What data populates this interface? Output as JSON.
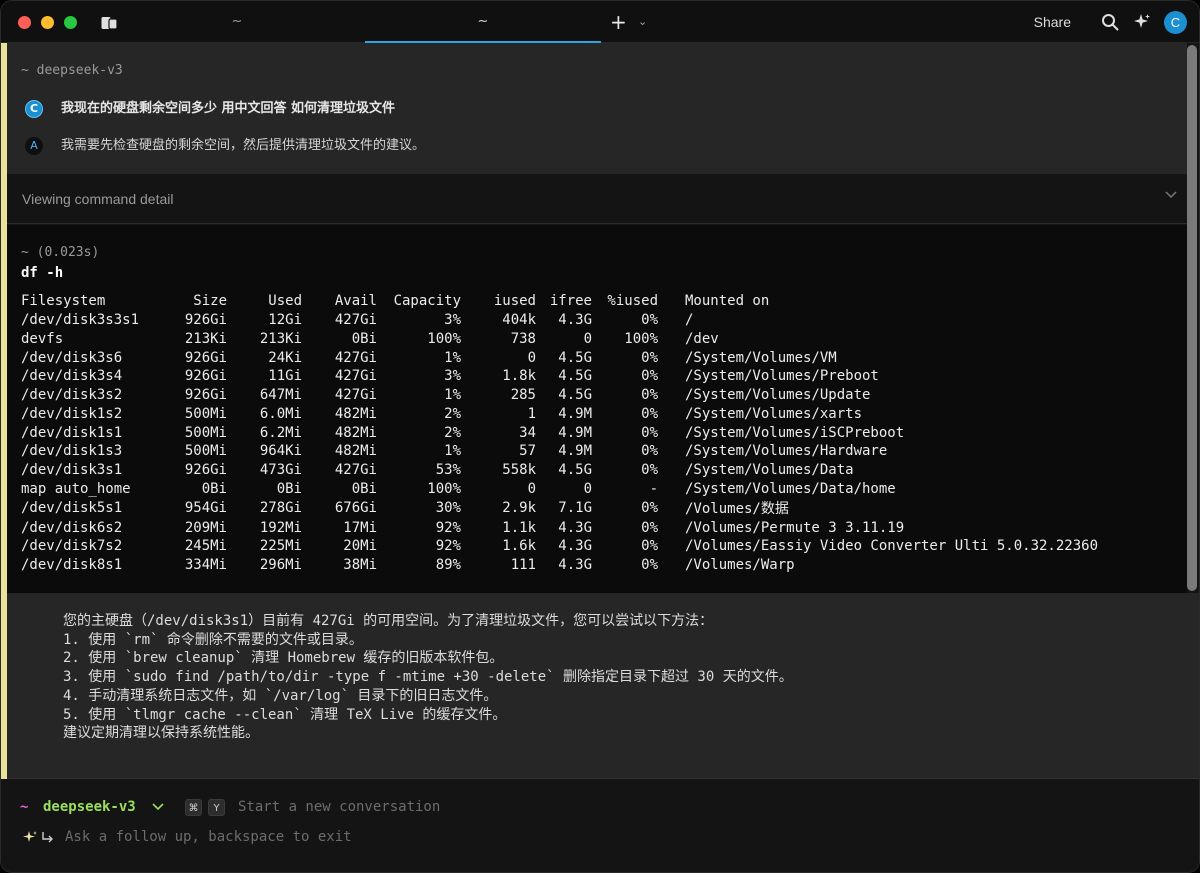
{
  "titlebar": {
    "tabs": [
      {
        "label": "~"
      },
      {
        "label": "~"
      }
    ],
    "new_tab_icon": "plus-icon",
    "share_label": "Share",
    "avatar_letter": "C",
    "accent_color": "#2aa6de"
  },
  "conversation": {
    "path": "~ deepseek-v3",
    "user_avatar": "C",
    "user_message": "我现在的硬盘剩余空间多少 用中文回答 如何清理垃圾文件",
    "ai_icon": "A",
    "ai_message": "我需要先检查硬盘的剩余空间，然后提供清理垃圾文件的建议。"
  },
  "detail": {
    "label": "Viewing command detail"
  },
  "command": {
    "time": "~ (0.023s)",
    "text": "df -h",
    "headers": [
      "Filesystem",
      "Size",
      "Used",
      "Avail",
      "Capacity",
      "iused",
      "ifree",
      "%iused",
      "Mounted on"
    ],
    "rows": [
      [
        "/dev/disk3s3s1",
        "926Gi",
        "12Gi",
        "427Gi",
        "3%",
        "404k",
        "4.3G",
        "0%",
        "/"
      ],
      [
        "devfs",
        "213Ki",
        "213Ki",
        "0Bi",
        "100%",
        "738",
        "0",
        "100%",
        "/dev"
      ],
      [
        "/dev/disk3s6",
        "926Gi",
        "24Ki",
        "427Gi",
        "1%",
        "0",
        "4.5G",
        "0%",
        "/System/Volumes/VM"
      ],
      [
        "/dev/disk3s4",
        "926Gi",
        "11Gi",
        "427Gi",
        "3%",
        "1.8k",
        "4.5G",
        "0%",
        "/System/Volumes/Preboot"
      ],
      [
        "/dev/disk3s2",
        "926Gi",
        "647Mi",
        "427Gi",
        "1%",
        "285",
        "4.5G",
        "0%",
        "/System/Volumes/Update"
      ],
      [
        "/dev/disk1s2",
        "500Mi",
        "6.0Mi",
        "482Mi",
        "2%",
        "1",
        "4.9M",
        "0%",
        "/System/Volumes/xarts"
      ],
      [
        "/dev/disk1s1",
        "500Mi",
        "6.2Mi",
        "482Mi",
        "2%",
        "34",
        "4.9M",
        "0%",
        "/System/Volumes/iSCPreboot"
      ],
      [
        "/dev/disk1s3",
        "500Mi",
        "964Ki",
        "482Mi",
        "1%",
        "57",
        "4.9M",
        "0%",
        "/System/Volumes/Hardware"
      ],
      [
        "/dev/disk3s1",
        "926Gi",
        "473Gi",
        "427Gi",
        "53%",
        "558k",
        "4.5G",
        "0%",
        "/System/Volumes/Data"
      ],
      [
        "map auto_home",
        "0Bi",
        "0Bi",
        "0Bi",
        "100%",
        "0",
        "0",
        "-",
        "/System/Volumes/Data/home"
      ],
      [
        "/dev/disk5s1",
        "954Gi",
        "278Gi",
        "676Gi",
        "30%",
        "2.9k",
        "7.1G",
        "0%",
        "/Volumes/数据"
      ],
      [
        "/dev/disk6s2",
        "209Mi",
        "192Mi",
        "17Mi",
        "92%",
        "1.1k",
        "4.3G",
        "0%",
        "/Volumes/Permute 3 3.11.19"
      ],
      [
        "/dev/disk7s2",
        "245Mi",
        "225Mi",
        "20Mi",
        "92%",
        "1.6k",
        "4.3G",
        "0%",
        "/Volumes/Eassiy Video Converter Ulti 5.0.32.22360"
      ],
      [
        "/dev/disk8s1",
        "334Mi",
        "296Mi",
        "38Mi",
        "89%",
        "111",
        "4.3G",
        "0%",
        "/Volumes/Warp"
      ]
    ]
  },
  "answer": {
    "lines": [
      "您的主硬盘（/dev/disk3s1）目前有 427Gi 的可用空间。为了清理垃圾文件，您可以尝试以下方法：",
      "1. 使用 `rm` 命令删除不需要的文件或目录。",
      "2. 使用 `brew cleanup` 清理 Homebrew 缓存的旧版本软件包。",
      "3. 使用 `sudo find /path/to/dir -type f -mtime +30 -delete` 删除指定目录下超过 30 天的文件。",
      "4. 手动清理系统日志文件，如 `/var/log` 目录下的旧日志文件。",
      "5. 使用 `tlmgr cache --clean` 清理 TeX Live 的缓存文件。",
      "建议定期清理以保持系统性能。"
    ]
  },
  "input": {
    "prompt_symbol": "~",
    "model": "deepseek-v3",
    "kbd_cmd": "⌘",
    "kbd_key": "Y",
    "new_conversation_placeholder": "Start a new conversation",
    "followup_placeholder": "Ask a follow up, backspace to exit"
  }
}
